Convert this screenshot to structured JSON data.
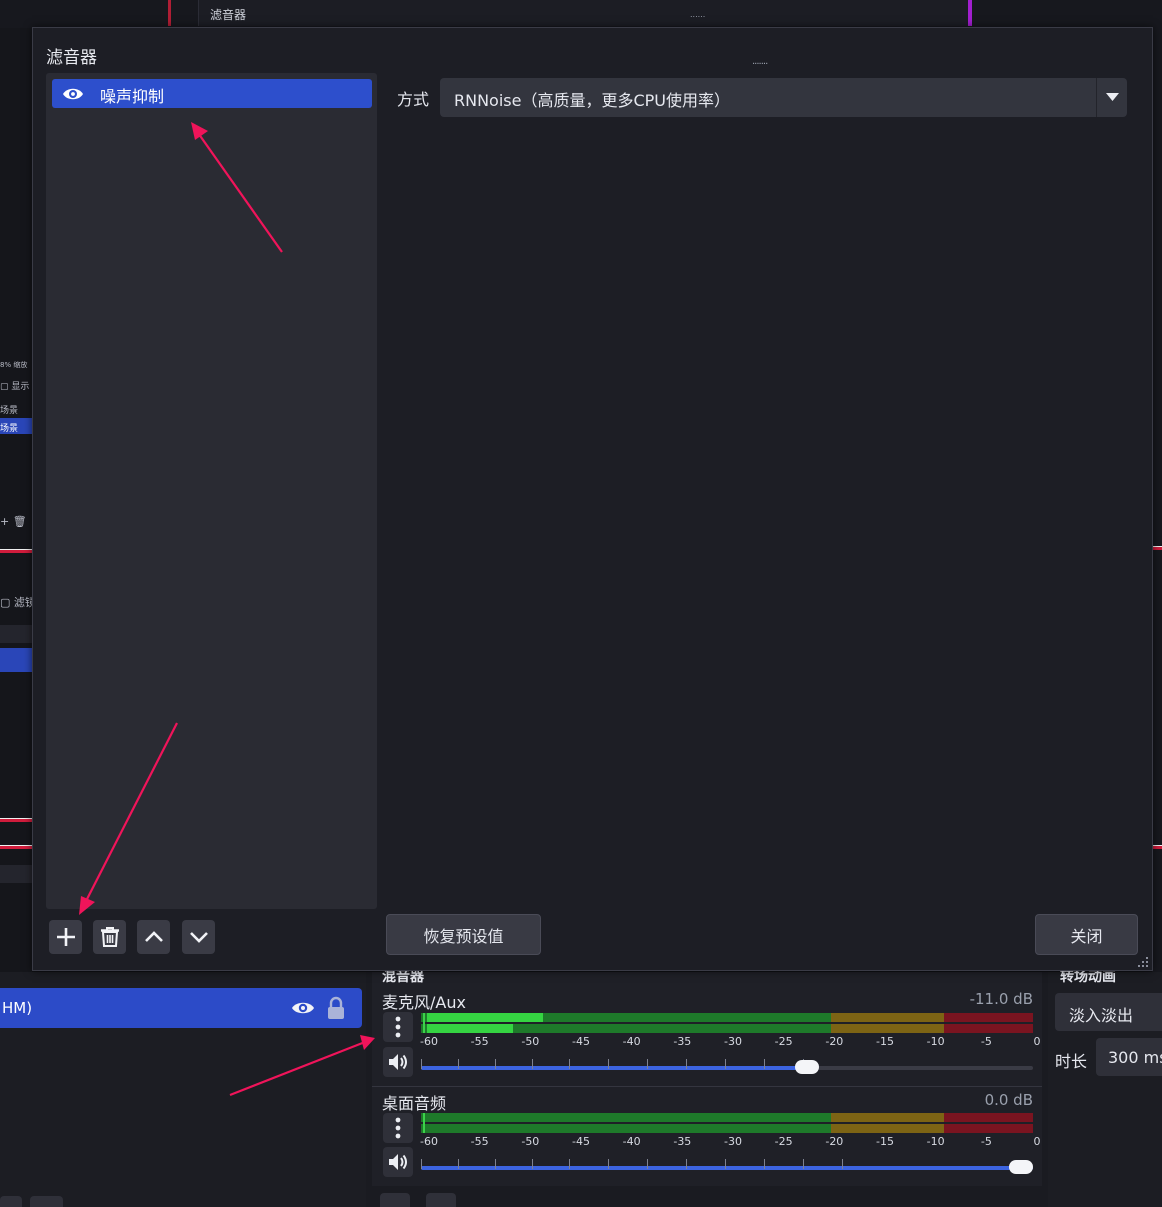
{
  "background": {
    "top_title": "滤音器",
    "left_texts": [
      "8%",
      "缩放",
      "显示",
      "场景",
      "场景",
      "滤镜"
    ],
    "source_item_label": "HM)"
  },
  "dialog": {
    "title": "滤音器",
    "filters": [
      {
        "name": "噪声抑制",
        "visible": true,
        "selected": true
      }
    ],
    "method_label": "方式",
    "method_value": "RNNoise（高质量，更多CPU使用率）",
    "reset_button": "恢复预设值",
    "close_button": "关闭"
  },
  "mixer": {
    "header": "混音器",
    "scale_labels": [
      "-60",
      "-55",
      "-50",
      "-45",
      "-40",
      "-35",
      "-30",
      "-25",
      "-20",
      "-15",
      "-10",
      "-5",
      "0"
    ],
    "channels": [
      {
        "name": "麦克风/Aux",
        "db": "-11.0 dB",
        "volume": 0.63,
        "level_top": 0.19,
        "level_bottom": 0.14
      },
      {
        "name": "桌面音频",
        "db": "0.0 dB",
        "volume": 1.0,
        "level_top": 0.0,
        "level_bottom": 0.0
      }
    ]
  },
  "transition": {
    "header": "转场动画",
    "type": "淡入淡出",
    "duration_label": "时长",
    "duration_value": "300 ms"
  },
  "colors": {
    "accent": "#2d4fcc",
    "annotation": "#f0145a",
    "meter_green": "#1e7a2a",
    "meter_yellow": "#7d6414",
    "meter_red": "#7a1420"
  }
}
